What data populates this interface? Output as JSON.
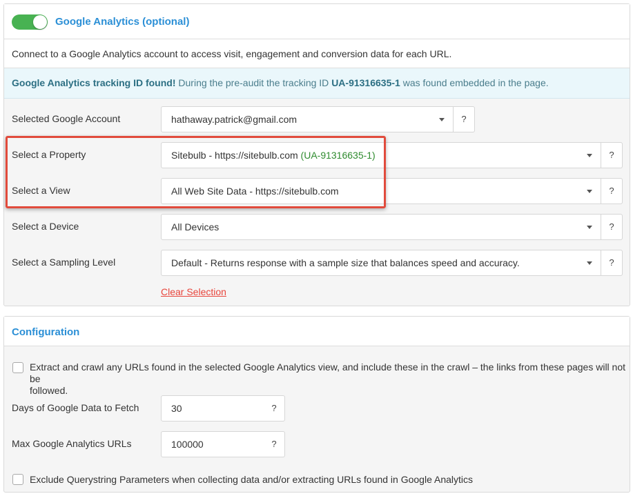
{
  "ga_section": {
    "title": "Google Analytics (optional)",
    "toggle_on": true,
    "description": "Connect to a Google Analytics account to access visit, engagement and conversion data for each URL.",
    "alert": {
      "strong": "Google Analytics tracking ID found!",
      "text_before": "During the pre-audit the tracking ID",
      "tracking_id": "UA-91316635-1",
      "text_after": "was found embedded in the page."
    },
    "fields": {
      "account": {
        "label": "Selected Google Account",
        "value": "hathaway.patrick@gmail.com"
      },
      "property": {
        "label": "Select a Property",
        "value": "Sitebulb - https://sitebulb.com",
        "value_id": "(UA-91316635-1)"
      },
      "view": {
        "label": "Select a View",
        "value": "All Web Site Data - https://sitebulb.com"
      },
      "device": {
        "label": "Select a Device",
        "value": "All Devices"
      },
      "sampling": {
        "label": "Select a Sampling Level",
        "value": "Default - Returns response with a sample size that balances speed and accuracy."
      }
    },
    "help_label": "?",
    "clear_selection": "Clear Selection"
  },
  "config_section": {
    "title": "Configuration",
    "extract_option": {
      "checked": false,
      "line1": "Extract and crawl any URLs found in the selected Google Analytics view, and include these in the crawl – the links from these pages will not be",
      "line2": "followed."
    },
    "days": {
      "label": "Days of Google Data to Fetch",
      "value": "30"
    },
    "max_urls": {
      "label": "Max Google Analytics URLs",
      "value": "100000"
    },
    "exclude_option": {
      "checked": false,
      "text": "Exclude Querystring Parameters when collecting data and/or extracting URLs found in Google Analytics"
    },
    "help_label": "?"
  },
  "colors": {
    "accent": "#2b8fd6",
    "toggle": "#48b252",
    "highlight": "#e14b3c",
    "link": "#e8453c"
  }
}
